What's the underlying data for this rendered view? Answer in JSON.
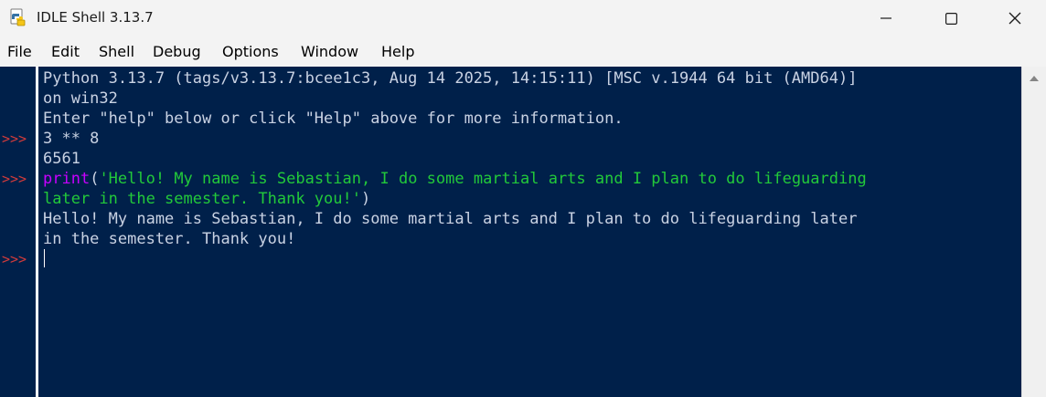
{
  "window": {
    "title": "IDLE Shell 3.13.7",
    "icons": {
      "app": "python-idle-icon",
      "minimize": "minimize-icon",
      "maximize": "maximize-icon",
      "close": "close-icon"
    }
  },
  "menu": {
    "items": [
      "File",
      "Edit",
      "Shell",
      "Debug",
      "Options",
      "Window",
      "Help"
    ]
  },
  "colors": {
    "shell_background": "#00204a",
    "prompt": "#d23b3b",
    "output_text": "#c9d2e3",
    "builtin": "#c800ff",
    "string": "#22c93a"
  },
  "shell": {
    "banner": [
      "Python 3.13.7 (tags/v3.13.7:bcee1c3, Aug 14 2025, 14:15:11) [MSC v.1944 64 bit (AMD64)]",
      "on win32",
      "Enter \"help\" below or click \"Help\" above for more information."
    ],
    "prompt": ">>>",
    "entries": [
      {
        "input": "3 ** 8",
        "output": [
          "6561"
        ]
      },
      {
        "input_builtin": "print",
        "input_open": "(",
        "input_string_line1": "'Hello! My name is Sebastian, I do some martial arts and I plan to do lifeguarding",
        "input_string_line2": "later in the semester. Thank you!'",
        "input_close": ")",
        "output": [
          "Hello! My name is Sebastian, I do some martial arts and I plan to do lifeguarding later",
          "in the semester. Thank you!"
        ]
      }
    ]
  }
}
